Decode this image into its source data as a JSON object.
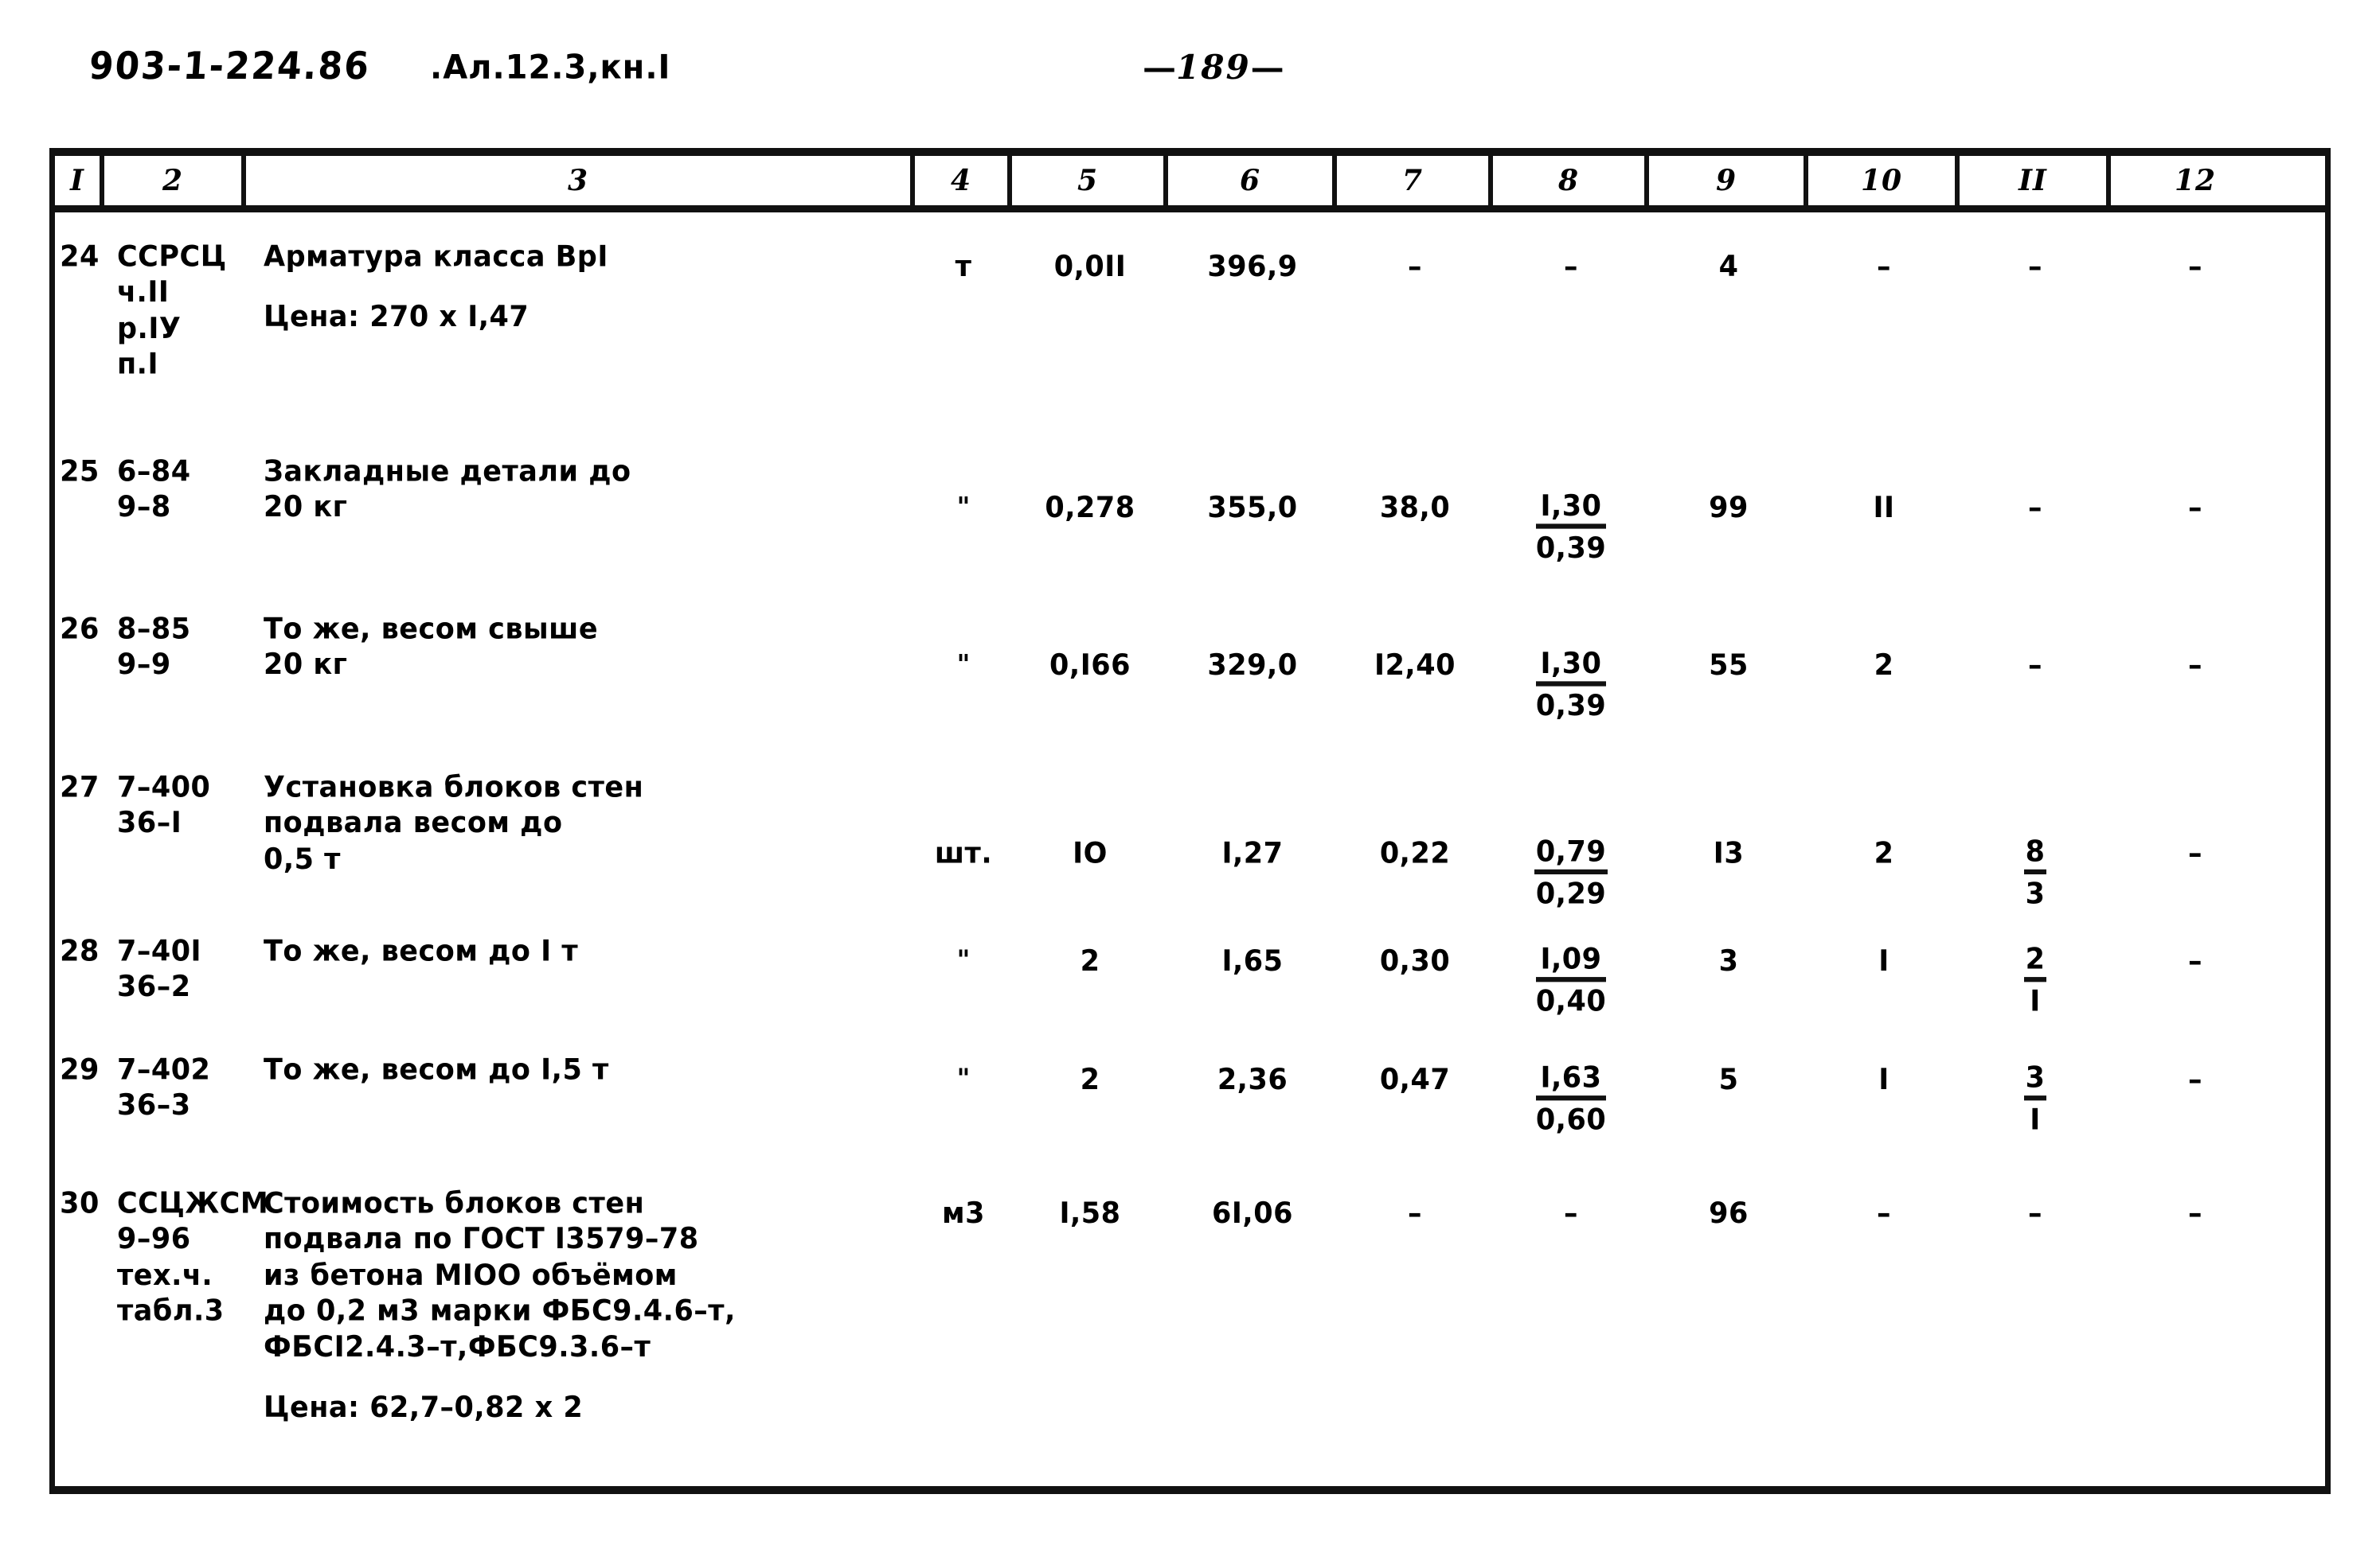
{
  "header": {
    "doc_code": "903-1-224.86",
    "doc_sub": ".Ал.12.3,кн.I",
    "page_number": "189",
    "page_dash_left": "—",
    "page_dash_right": "—"
  },
  "table": {
    "column_headers": [
      "I",
      "2",
      "3",
      "4",
      "5",
      "6",
      "7",
      "8",
      "9",
      "10",
      "II",
      "12"
    ],
    "rows": [
      {
        "no": "24",
        "code": "ССРСЦ\nч.II\nр.IУ\nп.I",
        "desc": "Арматура класса ВрI",
        "desc_extra": "Цена: 270 х I,47",
        "unit": "т",
        "c5": "0,0II",
        "c6": "396,9",
        "c7": "–",
        "c8_top": "",
        "c8_bot": "",
        "c8_plain": "–",
        "c9": "4",
        "c10": "–",
        "c11_top": "",
        "c11_bot": "",
        "c11_plain": "–",
        "c12": "–"
      },
      {
        "no": "25",
        "code": "6–84\n9–8",
        "desc": "Закладные детали до\n20 кг",
        "desc_extra": "",
        "unit": "\"",
        "c5": "0,278",
        "c6": "355,0",
        "c7": "38,0",
        "c8_top": "I,30",
        "c8_bot": "0,39",
        "c8_plain": "",
        "c9": "99",
        "c10": "II",
        "c11_top": "",
        "c11_bot": "",
        "c11_plain": "–",
        "c12": "–"
      },
      {
        "no": "26",
        "code": "8–85\n9–9",
        "desc": "То же, весом свыше\n20 кг",
        "desc_extra": "",
        "unit": "\"",
        "c5": "0,I66",
        "c6": "329,0",
        "c7": "I2,40",
        "c8_top": "I,30",
        "c8_bot": "0,39",
        "c8_plain": "",
        "c9": "55",
        "c10": "2",
        "c11_top": "",
        "c11_bot": "",
        "c11_plain": "–",
        "c12": "–"
      },
      {
        "no": "27",
        "code": "7–400\n36–I",
        "desc": "Установка блоков стен\nподвала весом до\n0,5 т",
        "desc_extra": "",
        "unit": "шт.",
        "c5": "IO",
        "c6": "I,27",
        "c7": "0,22",
        "c8_top": "0,79",
        "c8_bot": "0,29",
        "c8_plain": "",
        "c9": "I3",
        "c10": "2",
        "c11_top": "8",
        "c11_bot": "3",
        "c11_plain": "",
        "c12": "–"
      },
      {
        "no": "28",
        "code": "7–40I\n36–2",
        "desc": "То же, весом до I т",
        "desc_extra": "",
        "unit": "\"",
        "c5": "2",
        "c6": "I,65",
        "c7": "0,30",
        "c8_top": "I,09",
        "c8_bot": "0,40",
        "c8_plain": "",
        "c9": "3",
        "c10": "I",
        "c11_top": "2",
        "c11_bot": "I",
        "c11_plain": "",
        "c12": "–"
      },
      {
        "no": "29",
        "code": "7–402\n36–3",
        "desc": "То же, весом до I,5 т",
        "desc_extra": "",
        "unit": "\"",
        "c5": "2",
        "c6": "2,36",
        "c7": "0,47",
        "c8_top": "I,63",
        "c8_bot": "0,60",
        "c8_plain": "",
        "c9": "5",
        "c10": "I",
        "c11_top": "3",
        "c11_bot": "I",
        "c11_plain": "",
        "c12": "–"
      },
      {
        "no": "30",
        "code": "ССЦЖСМ\n9–96\nтех.ч.\nтабл.3",
        "desc": "Стоимость блоков стен\nподвала по ГОСТ I3579–78\nиз бетона МIОО объёмом\nдо 0,2 м3 марки ФБС9.4.6–т,\nФБСI2.4.3–т,ФБС9.3.6–т",
        "desc_extra": "Цена: 62,7–0,82 х 2",
        "unit": "м3",
        "c5": "I,58",
        "c6": "6I,06",
        "c7": "–",
        "c8_top": "",
        "c8_bot": "",
        "c8_plain": "–",
        "c9": "96",
        "c10": "–",
        "c11_top": "",
        "c11_bot": "",
        "c11_plain": "–",
        "c12": "–"
      }
    ]
  }
}
